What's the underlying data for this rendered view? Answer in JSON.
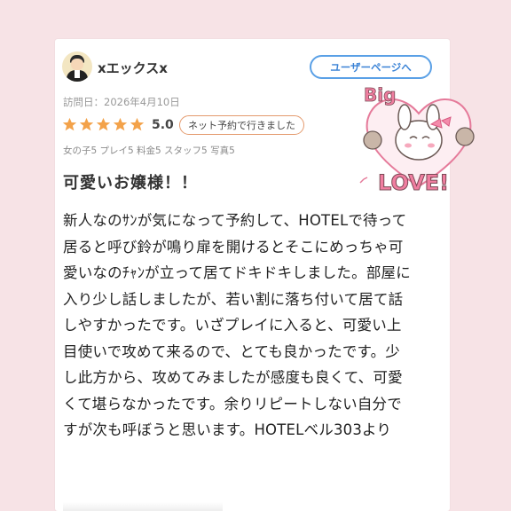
{
  "review": {
    "username": "xエックスx",
    "user_page_button": "ユーザーページへ",
    "visit_date": "訪問日：2026年4月10日",
    "rating": "5.0",
    "rating_stars": 5,
    "booking_badge": "ネット予約で行きました",
    "sub_ratings": "女の子5 プレイ5 料金5 スタッフ5 写真5",
    "title": "可愛いお嬢様！！",
    "lines": [
      "新人なのｻﾝが気になって予約して、HOTELで待って",
      "居ると呼び鈴が鳴り扉を開けるとそこにめっちゃ可",
      "愛いなのﾁｬﾝが立って居てドキドキしました。部屋に",
      "入り少し話しましたが、若い割に落ち付いて居て話",
      "しやすかったです。いざプレイに入ると、可愛い上",
      "目使いで攻めて来るので、とても良かったです。少",
      "し此方から、攻めてみましたが感度も良くて、可愛",
      "くて堪らなかったです。余りリピートしない自分で",
      "すが次も呼ぼうと思います。HOTELベル303より"
    ]
  },
  "sticker": {
    "text_top": "Big",
    "text_bottom": "LOVE!"
  },
  "colors": {
    "star": "#f3a24a",
    "button_border": "#5aa0e6",
    "badge_border": "#e49a6d",
    "background": "#f7e3e6"
  }
}
